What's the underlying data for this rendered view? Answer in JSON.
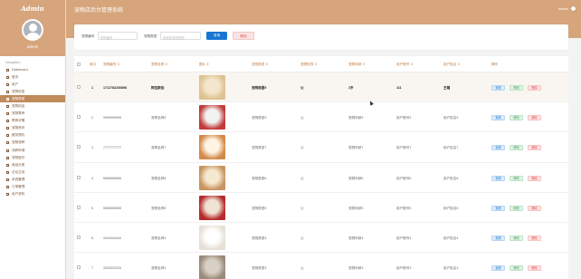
{
  "app": {
    "brand": "Admin",
    "page_title": "宠物店后台管理系统",
    "user": "admin",
    "top_user": "admin"
  },
  "sidebar": {
    "caption": "Navigation",
    "items": [
      {
        "label": "Dashboard",
        "icon": "dashboard-icon"
      },
      {
        "label": "首页",
        "icon": "home-icon"
      },
      {
        "label": "用户",
        "icon": "user-icon"
      },
      {
        "label": "宠物信息",
        "icon": "list-icon"
      },
      {
        "label": "宠物类型",
        "icon": "list-icon",
        "active": true
      },
      {
        "label": "宠物用品",
        "icon": "list-icon"
      },
      {
        "label": "宠物寄养",
        "icon": "list-icon"
      },
      {
        "label": "寄养详情",
        "icon": "list-icon"
      },
      {
        "label": "宠物资讯",
        "icon": "list-icon"
      },
      {
        "label": "服务预约",
        "icon": "list-icon"
      },
      {
        "label": "宠物领养",
        "icon": "list-icon"
      },
      {
        "label": "领养申请",
        "icon": "list-icon"
      },
      {
        "label": "宠物医疗",
        "icon": "list-icon"
      },
      {
        "label": "商品分类",
        "icon": "list-icon"
      },
      {
        "label": "论坛交流",
        "icon": "list-icon"
      },
      {
        "label": "系统管理",
        "icon": "settings-icon",
        "chev": "⌵"
      },
      {
        "label": "订单管理",
        "icon": "order-icon",
        "chev": "⌵"
      },
      {
        "label": "用户资料",
        "icon": "profile-icon",
        "chev": "⌵"
      }
    ]
  },
  "search": {
    "label1": "宠物编号",
    "placeholder1": "宠物编号",
    "label2": "宠物类型",
    "placeholder2": "请选择宠物类型",
    "search_label": "查询",
    "delete_label": "删除"
  },
  "table": {
    "headers": [
      "索引",
      "宠物编号 ⇕",
      "宠物名称 ⇕",
      "图片 ⇕",
      "宠物类型 ⇕",
      "宠物性别 ⇕",
      "宠物年龄 ⇕",
      "用户账号 ⇕",
      "用户姓名 ⇕",
      "操作"
    ],
    "rows": [
      {
        "index": "1",
        "code": "1712782230898",
        "name": "阿拉斯加",
        "type": "宠物类型5",
        "gender": "公",
        "age": "2岁",
        "account": "111",
        "uname": "王璐",
        "highlight": true,
        "thumb": [
          "#ddc28f",
          "#f4e6cc"
        ]
      },
      {
        "index": "2",
        "code": "9999999999",
        "name": "宠物名称9",
        "type": "宠物类型9",
        "gender": "公",
        "age": "宠物年龄9",
        "account": "用户账号9",
        "uname": "用户姓名9",
        "thumb": [
          "#c23a3a",
          "#f2f2f2"
        ]
      },
      {
        "index": "3",
        "code": "7777777777",
        "name": "宠物名称7",
        "type": "宠物类型7",
        "gender": "公",
        "age": "宠物年龄7",
        "account": "用户账号7",
        "uname": "用户姓名7",
        "thumb": [
          "#d28a4a",
          "#fff4e2"
        ]
      },
      {
        "index": "4",
        "code": "6666666666",
        "name": "宠物名称6",
        "type": "宠物类型6",
        "gender": "公",
        "age": "宠物年龄6",
        "account": "用户账号6",
        "uname": "用户姓名6",
        "thumb": [
          "#c89460",
          "#f7e8d0"
        ]
      },
      {
        "index": "5",
        "code": "5555555555",
        "name": "宠物名称5",
        "type": "宠物类型5",
        "gender": "公",
        "age": "宠物年龄5",
        "account": "用户账号5",
        "uname": "用户姓名5",
        "thumb": [
          "#b52a2a",
          "#efe4d4"
        ]
      },
      {
        "index": "6",
        "code": "4444444444",
        "name": "宠物名称4",
        "type": "宠物类型4",
        "gender": "公",
        "age": "宠物年龄4",
        "account": "用户账号4",
        "uname": "用户姓名4",
        "thumb": [
          "#e6e0d6",
          "#ffffff"
        ]
      },
      {
        "index": "7",
        "code": "3333333333",
        "name": "宠物名称3",
        "type": "宠物类型3",
        "gender": "公",
        "age": "宠物年龄3",
        "account": "用户账号3",
        "uname": "用户姓名3",
        "thumb": [
          "#9a8a7a",
          "#d8d0c4"
        ]
      }
    ],
    "actions": {
      "view": "查看",
      "edit": "修改",
      "delete": "删除"
    }
  }
}
